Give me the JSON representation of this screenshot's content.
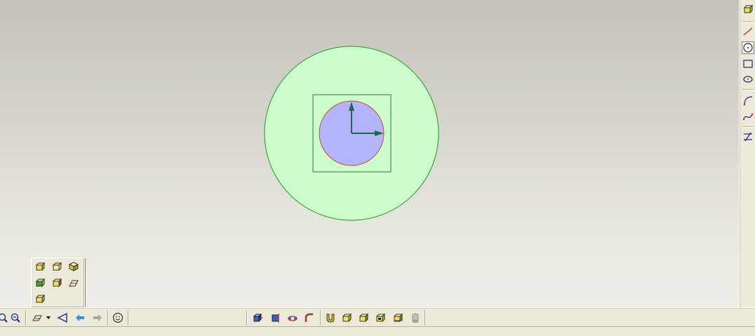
{
  "viewport": {
    "background_top": "#c4c3bb",
    "background_bottom": "#efeee8",
    "sketch": {
      "outer_circle": {
        "fill": "#ccfccc",
        "stroke": "#1a9a1a"
      },
      "bounding_square": {
        "stroke": "#2a7a3a"
      },
      "inner_circle": {
        "fill": "#b4b4fc",
        "stroke": "#c05030"
      },
      "axes": {
        "color": "#1a6a4a"
      }
    }
  },
  "right_toolbar": {
    "buttons": [
      {
        "name": "layer-cube-icon",
        "active": false
      },
      {
        "name": "line-icon",
        "active": false
      },
      {
        "name": "circle-icon",
        "active": true
      },
      {
        "name": "rectangle-icon",
        "active": false
      },
      {
        "name": "ellipse-icon",
        "active": false
      },
      {
        "name": "arc-icon",
        "active": false
      },
      {
        "name": "spline-icon",
        "active": false
      },
      {
        "name": "trim-icon",
        "active": false
      }
    ]
  },
  "view_flyout": {
    "buttons": [
      "view-front-icon",
      "view-top-icon",
      "view-iso-icon",
      "view-left-icon",
      "view-right-icon",
      "view-plane-icon",
      "view-back-icon"
    ]
  },
  "bottom_toolbar": {
    "left_buttons": [
      "zoom-icon",
      "zoom-out-icon",
      "view-orientation-icon",
      "dropdown-arrow-icon",
      "normal-view-icon",
      "previous-view-icon",
      "next-view-icon",
      "smiley-icon"
    ],
    "middle_buttons": [
      "extrude-icon",
      "revolve-icon",
      "sweep-icon",
      "loft-icon",
      "fillet-icon",
      "solid-box-icon",
      "shade-icon",
      "wireframe-icon",
      "shell-icon",
      "cylinder-icon"
    ]
  },
  "accent_color": "#0a8a3a"
}
